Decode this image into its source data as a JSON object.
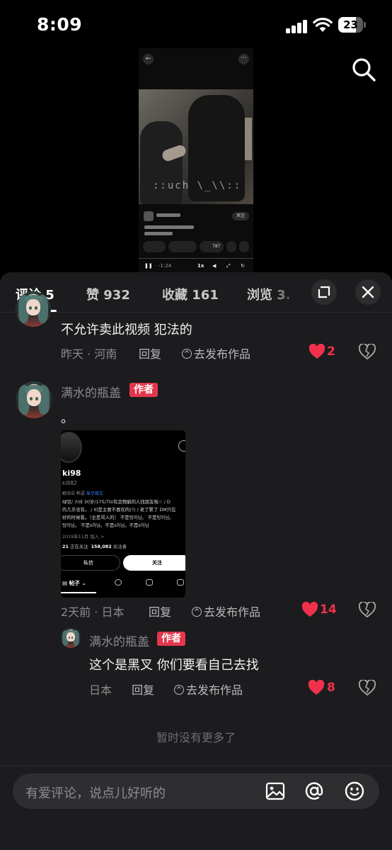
{
  "status_bar": {
    "time": "8:09",
    "battery": "23"
  },
  "video_preview": {
    "watermark": "::uch \\_\\\\::",
    "follow_label": "关注",
    "time_current": "-1:24",
    "speed": "1x",
    "share_count": "787"
  },
  "tabs": [
    {
      "label": "评论 5"
    },
    {
      "label": "赞 932"
    },
    {
      "label": "收藏 161"
    },
    {
      "label": "浏览 3."
    }
  ],
  "comments": [
    {
      "text": "不允许卖此视频 犯法的",
      "time_location": "昨天 · 河南",
      "reply_label": "回复",
      "publish_label": "去发布作品",
      "likes": "2"
    },
    {
      "author": "满水的瓶盖",
      "badge": "作者",
      "text": "。",
      "time_location": "2天前 · 日本",
      "reply_label": "回复",
      "publish_label": "去发布作品",
      "likes": "14",
      "attachment": {
        "name": "ki98",
        "handle": "ki982",
        "translate_prefix": "翻译自 韩语",
        "translate_link": "显示原文",
        "bio_lines": [
          "绿豆/ 스바 30岁/175/70/有恋物癖的人找朋友啦☆ / D",
          "的几乎没有。 / 비是主要不喜欢的(?) / 老了累了 DM只在",
          "好的时候看。（全是骂人的） 不是팅이님。 不是팅이님。",
          "팅이님。 不是s이님。不是s이님。不是s이님"
        ],
        "joined": "2019年11月 加入 >",
        "stats_prefix": "21",
        "stats_following_label": "正在关注",
        "stats_followers": "158,082",
        "stats_followers_label": "关注者",
        "dm_label": "私信",
        "follow_label": "关注",
        "tab_posts": "帖子"
      }
    },
    {
      "author": "满水的瓶盖",
      "badge": "作者",
      "text": "这个是黑叉 你们要看自己去找",
      "time_location": "日本",
      "reply_label": "回复",
      "publish_label": "去发布作品",
      "likes": "8"
    }
  ],
  "no_more": "暂时没有更多了",
  "input": {
    "placeholder": "有爱评论，说点儿好听的"
  },
  "colors": {
    "accent": "#f0314c",
    "badge": "#e5374c",
    "sheet": "#1c1c1e"
  }
}
